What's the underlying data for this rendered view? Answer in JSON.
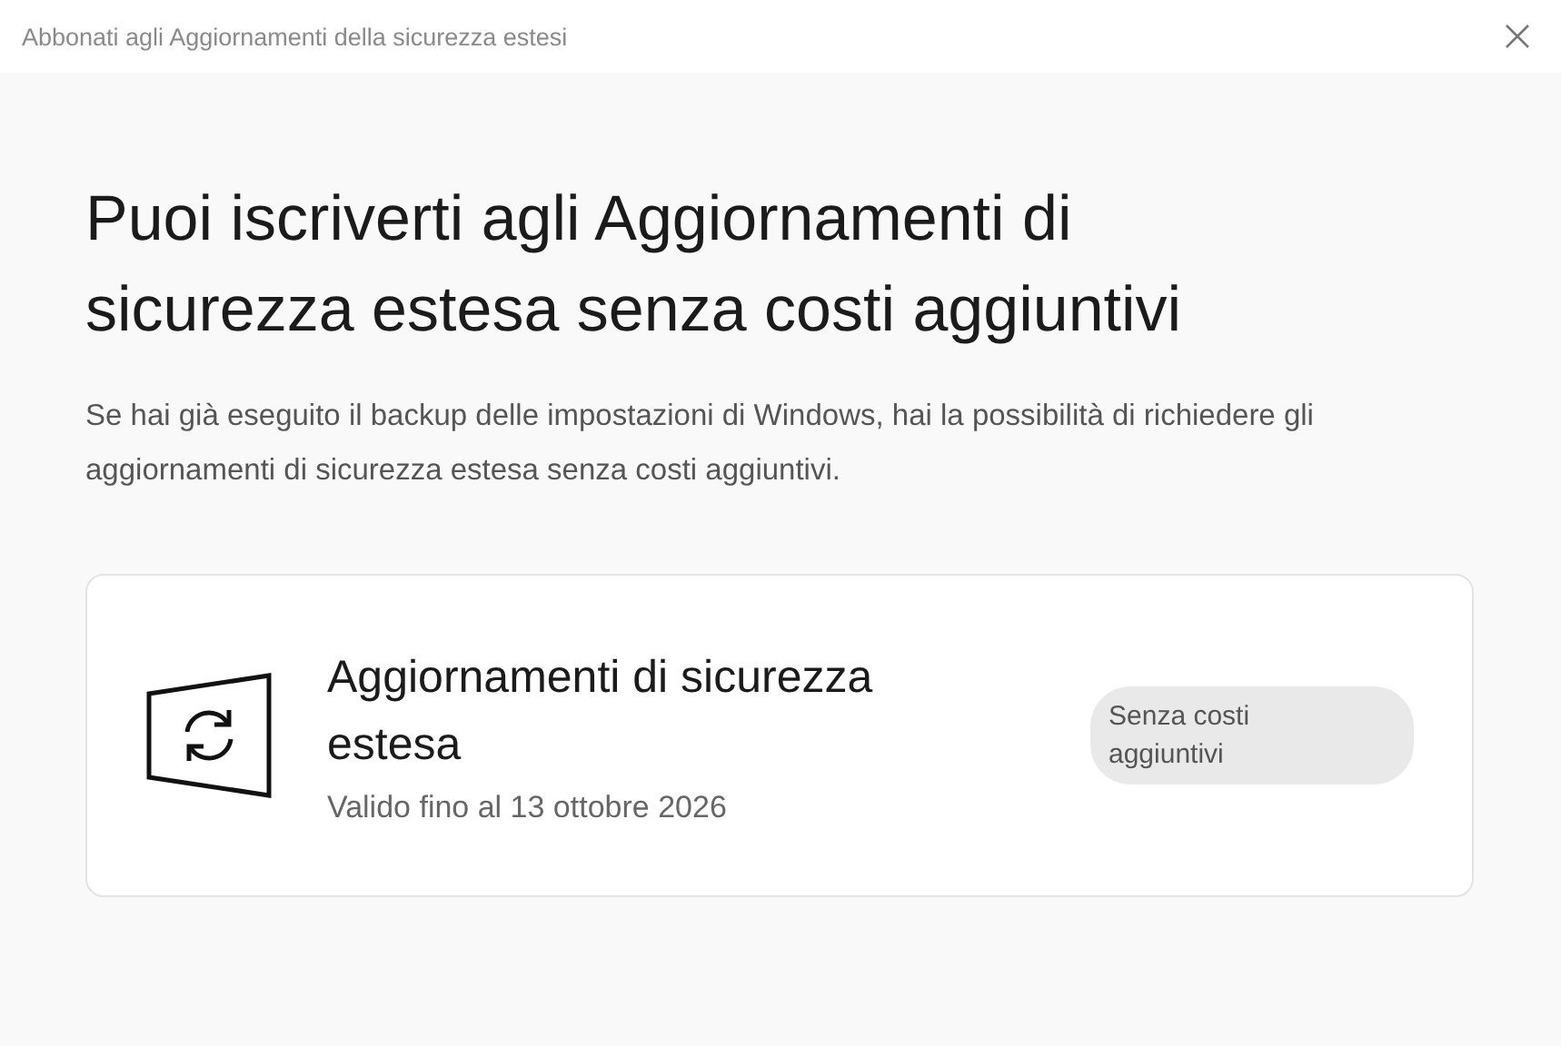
{
  "window": {
    "title": "Abbonati agli Aggiornamenti della sicurezza estesi"
  },
  "heading": "Puoi iscriverti agli Aggiornamenti di sicurezza estesa senza costi aggiuntivi",
  "description": "Se hai già eseguito il backup delle impostazioni di Windows, hai la possibilità di richiedere gli aggiornamenti di sicurezza estesa senza costi aggiuntivi.",
  "offer": {
    "title": "Aggiornamenti di sicurezza estesa",
    "subtitle": "Valido fino al 13 ottobre 2026",
    "badge": "Senza costi aggiuntivi"
  }
}
